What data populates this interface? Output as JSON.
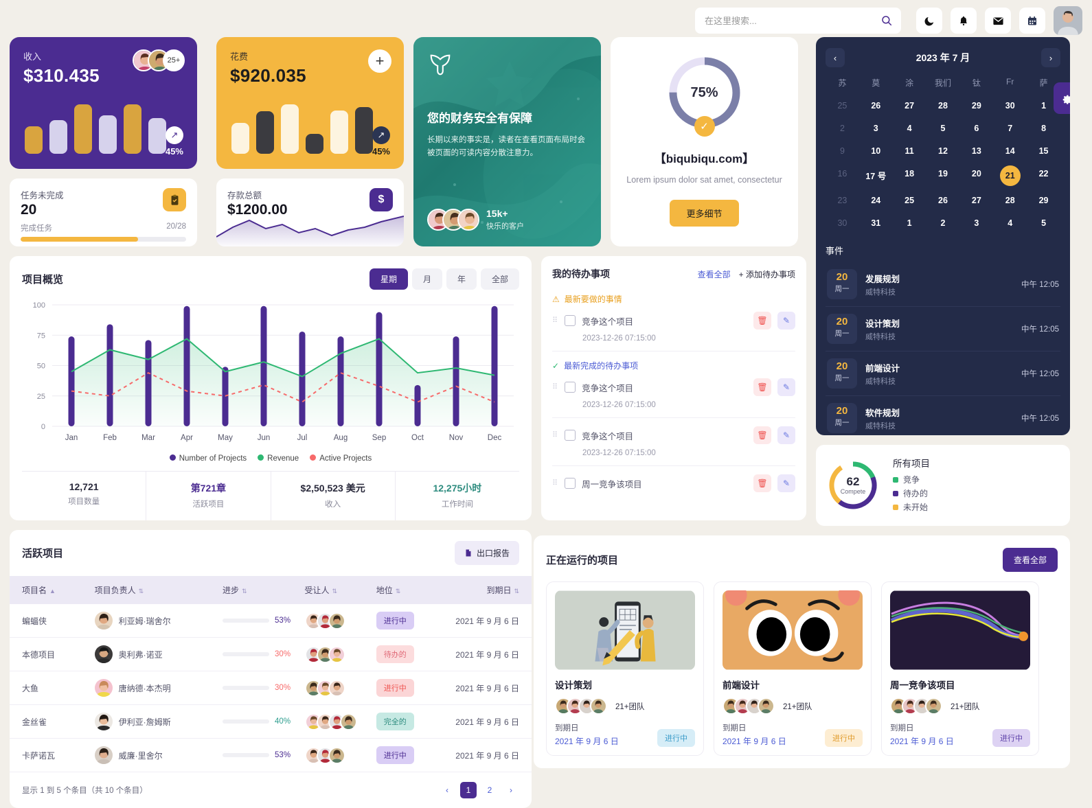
{
  "topbar": {
    "search_placeholder": "在这里搜索...",
    "icons": [
      "moon-icon",
      "bell-icon",
      "mail-icon",
      "calendar-icon"
    ],
    "avatar_label": "用户头像"
  },
  "stat_cards": [
    {
      "label": "收入",
      "value": "$310.435",
      "percent": "45%",
      "avatar_more": "25+",
      "theme": "purple",
      "bars": [
        55,
        68,
        100,
        78,
        100,
        72
      ]
    },
    {
      "label": "花费",
      "value": "$920.035",
      "percent": "45%",
      "theme": "amber",
      "bars": [
        62,
        86,
        100,
        40,
        88,
        94
      ]
    }
  ],
  "small_cards": [
    {
      "label": "任务未完成",
      "value": "20",
      "sub_left": "完成任务",
      "sub_right": "20/28",
      "progress": 71,
      "icon": "clipboard-check-icon"
    },
    {
      "label": "存款总额",
      "value": "$1200.00",
      "icon": "dollar-icon"
    }
  ],
  "promo": {
    "title": "您的财务安全有保障",
    "text": "长期以来的事实是，读者在查看页面布局时会被页面的可读内容分散注意力。",
    "count": "15k+",
    "count_label": "快乐的客户"
  },
  "progress_card": {
    "percent_text": "75%",
    "percent": 75,
    "title": "【biqubiqu.com】",
    "desc": "Lorem ipsum dolor sat amet, consectetur",
    "button": "更多细节"
  },
  "calendar": {
    "month_title": "2023 年 7 月",
    "prev": "‹",
    "next": "›",
    "dow": [
      "苏",
      "莫",
      "涂",
      "我们",
      "钛",
      "Fr",
      "萨"
    ],
    "weeks": [
      [
        {
          "d": "25",
          "muted": true
        },
        {
          "d": "26"
        },
        {
          "d": "27"
        },
        {
          "d": "28"
        },
        {
          "d": "29"
        },
        {
          "d": "30"
        },
        {
          "d": "1"
        }
      ],
      [
        {
          "d": "2",
          "muted": true
        },
        {
          "d": "3"
        },
        {
          "d": "4"
        },
        {
          "d": "5"
        },
        {
          "d": "6"
        },
        {
          "d": "7"
        },
        {
          "d": "8"
        }
      ],
      [
        {
          "d": "9",
          "muted": true
        },
        {
          "d": "10"
        },
        {
          "d": "11"
        },
        {
          "d": "12"
        },
        {
          "d": "13"
        },
        {
          "d": "14"
        },
        {
          "d": "15"
        }
      ],
      [
        {
          "d": "16",
          "muted": true
        },
        {
          "d": "17 号"
        },
        {
          "d": "18"
        },
        {
          "d": "19"
        },
        {
          "d": "20"
        },
        {
          "d": "21",
          "today": true
        },
        {
          "d": "22"
        }
      ],
      [
        {
          "d": "23",
          "muted": true
        },
        {
          "d": "24"
        },
        {
          "d": "25"
        },
        {
          "d": "26"
        },
        {
          "d": "27"
        },
        {
          "d": "28"
        },
        {
          "d": "29"
        }
      ],
      [
        {
          "d": "30",
          "muted": true
        },
        {
          "d": "31"
        },
        {
          "d": "1"
        },
        {
          "d": "2"
        },
        {
          "d": "3"
        },
        {
          "d": "4"
        },
        {
          "d": "5"
        }
      ]
    ],
    "events_title": "事件",
    "events": [
      {
        "day": "20",
        "weekday": "周一",
        "name": "发展规划",
        "org": "威特科技",
        "time": "中午 12:05"
      },
      {
        "day": "20",
        "weekday": "周一",
        "name": "设计策划",
        "org": "威特科技",
        "time": "中午 12:05"
      },
      {
        "day": "20",
        "weekday": "周一",
        "name": "前端设计",
        "org": "威特科技",
        "time": "中午 12:05"
      },
      {
        "day": "20",
        "weekday": "周一",
        "name": "软件规划",
        "org": "威特科技",
        "time": "中午 12:05"
      }
    ]
  },
  "chart_card": {
    "title": "项目概览",
    "tabs": [
      {
        "label": "星期",
        "active": true
      },
      {
        "label": "月",
        "active": false
      },
      {
        "label": "年",
        "active": false
      },
      {
        "label": "全部",
        "active": false
      }
    ],
    "stats": [
      {
        "value": "12,721",
        "label": "项目数量",
        "color": "#2a2a3c"
      },
      {
        "value": "第721章",
        "label": "活跃项目",
        "color": "#4b2c91"
      },
      {
        "value": "$2,50,523 美元",
        "label": "收入",
        "color": "#2a2a3c"
      },
      {
        "value": "12,275小时",
        "label": "工作时间",
        "color": "#2e8c7f"
      }
    ]
  },
  "chart_data": {
    "type": "bar",
    "title": "项目概览",
    "categories": [
      "Jan",
      "Feb",
      "Mar",
      "Apr",
      "May",
      "Jun",
      "Jul",
      "Aug",
      "Sep",
      "Oct",
      "Nov",
      "Dec"
    ],
    "series": [
      {
        "name": "Number of Projects",
        "type": "bar",
        "color": "#4b2c91",
        "values": [
          74,
          84,
          71,
          99,
          49,
          99,
          78,
          74,
          94,
          34,
          74,
          99
        ]
      },
      {
        "name": "Revenue",
        "type": "area",
        "color": "#2eb872",
        "values": [
          45,
          63,
          55,
          72,
          45,
          53,
          41,
          60,
          72,
          44,
          48,
          42
        ]
      },
      {
        "name": "Active Projects",
        "type": "line-dashed",
        "color": "#f76a6a",
        "values": [
          29,
          25,
          44,
          29,
          25,
          34,
          20,
          44,
          33,
          20,
          33,
          20
        ]
      }
    ],
    "xlabel": "",
    "ylabel": "",
    "ylim": [
      0,
      100
    ],
    "yticks": [
      0,
      25,
      50,
      75,
      100
    ],
    "grid": true,
    "legend_position": "bottom"
  },
  "todo": {
    "title": "我的待办事项",
    "view_all": "查看全部",
    "add": "+ 添加待办事项",
    "section_pending": "最新要做的事情",
    "section_done": "最新完成的待办事项",
    "items": [
      {
        "text": "竞争这个项目",
        "date": "2023-12-26 07:15:00",
        "section": "pending"
      },
      {
        "text": "竞争这个项目",
        "date": "2023-12-26 07:15:00",
        "section": "done"
      },
      {
        "text": "竞争这个项目",
        "date": "2023-12-26 07:15:00",
        "section": null
      },
      {
        "text": "周一竞争该项目",
        "date": "",
        "section": null
      }
    ]
  },
  "donut": {
    "number": "62",
    "center_label": "Compete",
    "title": "所有项目",
    "legend": [
      {
        "label": "竞争",
        "color": "#2eb872"
      },
      {
        "label": "待办的",
        "color": "#4b2c91"
      },
      {
        "label": "未开始",
        "color": "#f4b740"
      }
    ],
    "segments": [
      28,
      42,
      30
    ]
  },
  "table": {
    "title": "活跃项目",
    "export": "出口报告",
    "columns": [
      "项目名",
      "项目负责人",
      "进步",
      "受让人",
      "地位",
      "到期日"
    ],
    "rows": [
      {
        "name": "蝙蝠侠",
        "lead": "利亚姆·瑞舍尔",
        "progress": 53,
        "progress_label": "53%",
        "progress_color": "#4b2c91",
        "assignees": 3,
        "status": "进行中",
        "status_bg": "#d9cdf5",
        "status_fg": "#4b2c91",
        "due": "2021 年 9 月 6 日"
      },
      {
        "name": "本德项目",
        "lead": "奥利弗·诺亚",
        "progress": 30,
        "progress_label": "30%",
        "progress_color": "#f76a6a",
        "assignees": 3,
        "status": "待办的",
        "status_bg": "#fcdcdd",
        "status_fg": "#e06a78",
        "due": "2021 年 9 月 6 日"
      },
      {
        "name": "大鱼",
        "lead": "唐纳德·本杰明",
        "progress": 30,
        "progress_label": "30%",
        "progress_color": "#f76a6a",
        "assignees": 3,
        "status": "进行中",
        "status_bg": "#fbd5d6",
        "status_fg": "#ef5350",
        "due": "2021 年 9 月 6 日"
      },
      {
        "name": "金丝雀",
        "lead": "伊利亚·詹姆斯",
        "progress": 40,
        "progress_label": "40%",
        "progress_color": "#2e9e8f",
        "assignees": 4,
        "status": "完全的",
        "status_bg": "#c6e9e3",
        "status_fg": "#2e8c7f",
        "due": "2021 年 9 月 6 日"
      },
      {
        "name": "卡萨诺瓦",
        "lead": "威廉·里舍尔",
        "progress": 53,
        "progress_label": "53%",
        "progress_color": "#4b2c91",
        "assignees": 3,
        "status": "进行中",
        "status_bg": "#d9cdf5",
        "status_fg": "#4b2c91",
        "due": "2021 年 9 月 6 日"
      }
    ],
    "footer_text": "显示 1 到 5 个条目（共 10 个条目）",
    "pages": [
      "1",
      "2"
    ]
  },
  "running": {
    "title": "正在运行的项目",
    "view_all": "查看全部",
    "projects": [
      {
        "name": "设计策划",
        "team": "21+团队",
        "due_label": "到期日",
        "due": "2021 年 9 月 6 日",
        "status": "进行中",
        "status_bg": "#d6edf7",
        "status_fg": "#3a9bc9",
        "thumb": "design-illustration"
      },
      {
        "name": "前端设计",
        "team": "21+团队",
        "due_label": "到期日",
        "due": "2021 年 9 月 6 日",
        "status": "进行中",
        "status_bg": "#fdedd2",
        "status_fg": "#e09a2a",
        "thumb": "face-illustration"
      },
      {
        "name": "周一竞争该项目",
        "team": "21+团队",
        "due_label": "到期日",
        "due": "2021 年 9 月 6 日",
        "status": "进行中",
        "status_bg": "#ddd2f3",
        "status_fg": "#5b3fa8",
        "thumb": "wave-chart"
      }
    ]
  }
}
